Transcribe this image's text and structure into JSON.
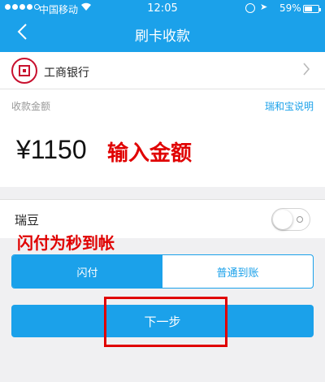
{
  "status_bar": {
    "carrier": "中国移动",
    "time": "12:05",
    "battery_pct": "59%",
    "battery_level": 0.59
  },
  "nav": {
    "title": "刷卡收款",
    "back_icon": "chevron-left-icon"
  },
  "bank": {
    "name": "工商银行",
    "logo_icon": "icbc-logo"
  },
  "amount": {
    "label": "收款金额",
    "help_link": "瑞和宝说明",
    "value": "¥1150",
    "annotation": "输入金额"
  },
  "bean": {
    "label": "瑞豆",
    "toggle_on": false
  },
  "annotation_instant": "闪付为秒到帐",
  "settlement_tabs": [
    {
      "label": "闪付",
      "active": true
    },
    {
      "label": "普通到账",
      "active": false
    }
  ],
  "next_button": "下一步",
  "colors": {
    "primary": "#1ba1ea",
    "annotation_red": "#e00000",
    "icbc_red": "#c8102e",
    "background": "#f0f0f2"
  }
}
